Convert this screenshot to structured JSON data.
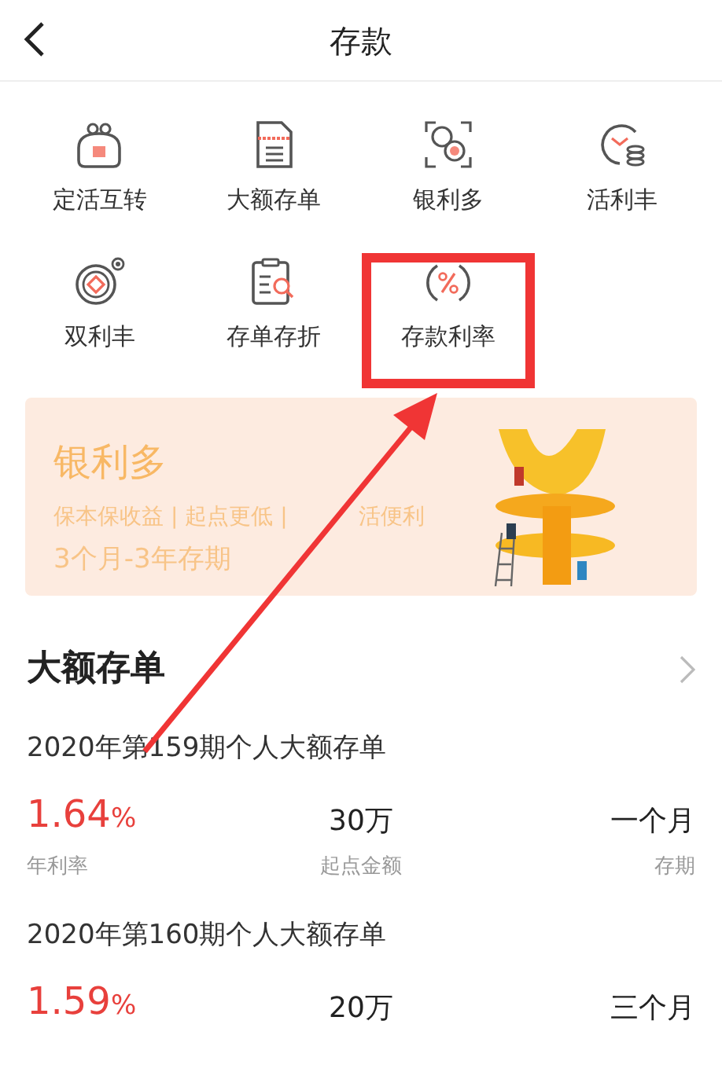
{
  "header": {
    "title": "存款"
  },
  "shortcuts": [
    {
      "kind": "purse",
      "label": "定活互转",
      "highlighted": false
    },
    {
      "kind": "document",
      "label": "大额存单",
      "highlighted": false
    },
    {
      "kind": "coin-scan",
      "label": "银利多",
      "highlighted": false
    },
    {
      "kind": "clock-coins",
      "label": "活利丰",
      "highlighted": false
    },
    {
      "kind": "coin",
      "label": "双利丰",
      "highlighted": false
    },
    {
      "kind": "clipboard-search",
      "label": "存单存折",
      "highlighted": false
    },
    {
      "kind": "percent",
      "label": "存款利率",
      "highlighted": true
    }
  ],
  "banner": {
    "title": "银利多",
    "subtitle_before": "保本保收益 | 起点更低 |",
    "subtitle_after": "活便利",
    "term": "3个月-3年存期"
  },
  "section": {
    "title": "大额存单"
  },
  "products": [
    {
      "name": "2020年第159期个人大额存单",
      "rate": "1.64",
      "rate_unit": "%",
      "amount": "30万",
      "term": "一个月",
      "rate_label": "年利率",
      "amount_label": "起点金额",
      "term_label": "存期"
    },
    {
      "name": "2020年第160期个人大额存单",
      "rate": "1.59",
      "rate_unit": "%",
      "amount": "20万",
      "term": "三个月"
    }
  ]
}
